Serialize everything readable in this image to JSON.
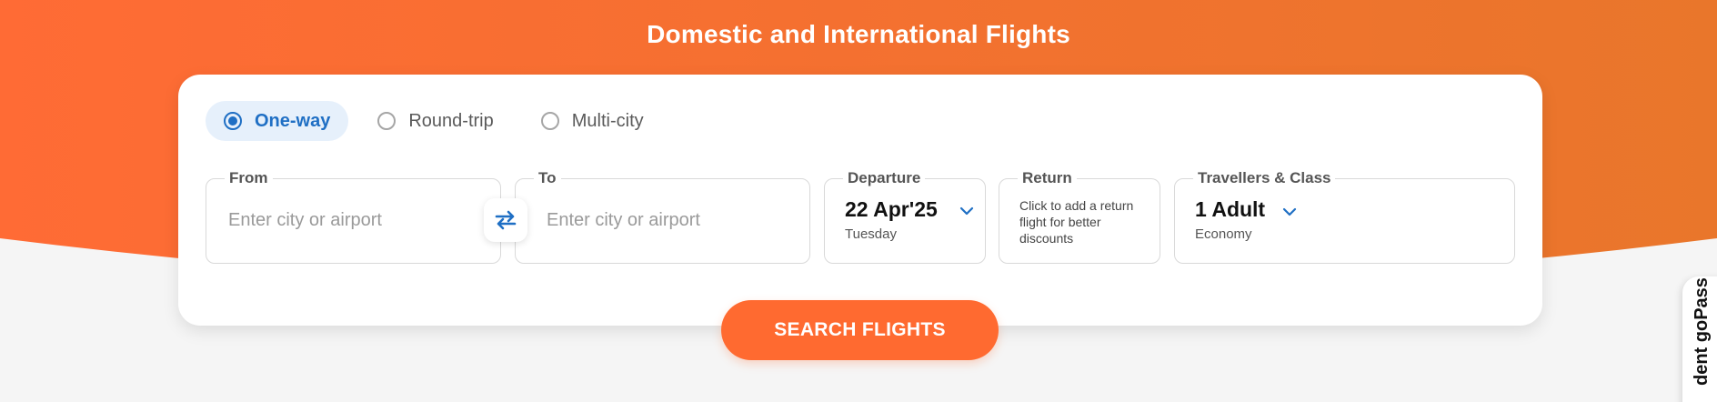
{
  "hero": {
    "title": "Domestic and International Flights",
    "gradient_start": "#ff6b35",
    "gradient_end": "#e9762b"
  },
  "trip_types": [
    {
      "label": "One-way",
      "selected": true
    },
    {
      "label": "Round-trip",
      "selected": false
    },
    {
      "label": "Multi-city",
      "selected": false
    }
  ],
  "from": {
    "label": "From",
    "placeholder": "Enter city or airport"
  },
  "swap": {
    "icon": "swap-arrows-icon"
  },
  "to": {
    "label": "To",
    "placeholder": "Enter city or airport"
  },
  "departure": {
    "label": "Departure",
    "date": "22 Apr'25",
    "day": "Tuesday"
  },
  "return": {
    "label": "Return",
    "hint": "Click to add a return flight for better discounts"
  },
  "travellers": {
    "label": "Travellers & Class",
    "count": "1 Adult",
    "class": "Economy"
  },
  "search": {
    "label": "SEARCH FLIGHTS",
    "color": "#ff6a30"
  },
  "side_tab": {
    "label": "dent goPass"
  },
  "colors": {
    "accent": "#1f6fc4",
    "background": "#f5f5f5"
  }
}
